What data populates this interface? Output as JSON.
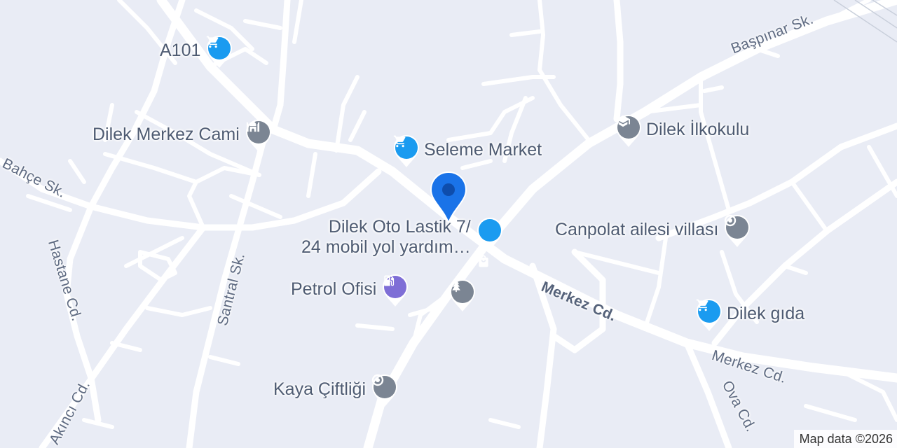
{
  "map": {
    "street_labels": {
      "bahce": "Bahçe Sk.",
      "baspinar": "Başpınar Sk.",
      "hastane": "Hastane Cd.",
      "santral": "Santral Sk.",
      "akinci": "Akıncı Cd.",
      "merkez_center": "Merkez Cd.",
      "merkez_right": "Merkez Cd.",
      "ova": "Ova Cd."
    },
    "pois": {
      "a101": {
        "label": "A101",
        "icon": "shopping-cart-icon",
        "color": "#1a9bf0"
      },
      "dilek_merkez_cami": {
        "label": "Dilek Merkez Cami",
        "icon": "mosque-icon",
        "color": "#7b8593"
      },
      "seleme_market": {
        "label": "Seleme Market",
        "icon": "shopping-cart-icon",
        "color": "#1a9bf0"
      },
      "dilek_ilkokulu": {
        "label": "Dilek İlkokulu",
        "icon": "school-icon",
        "color": "#7b8593"
      },
      "dilek_oto_lastik": {
        "label_line1": "Dilek Oto Lastik 7/",
        "label_line2": "24 mobil yol yardım…",
        "icon": "shopping-bag-icon",
        "color": "#1a9bf0"
      },
      "canpolat": {
        "label": "Canpolat ailesi villası",
        "icon": "place-icon",
        "color": "#7b8593"
      },
      "petrol_ofisi": {
        "label": "Petrol Ofisi",
        "icon": "gas-station-icon",
        "color": "#7e6ed6"
      },
      "park": {
        "icon": "park-icon",
        "color": "#7b8593"
      },
      "dilek_gida": {
        "label": "Dilek gıda",
        "icon": "shopping-cart-icon",
        "color": "#1a9bf0"
      },
      "kaya_ciftligi": {
        "label": "Kaya Çiftliği",
        "icon": "place-icon",
        "color": "#7b8593"
      }
    },
    "marker": {
      "icon": "location-marker-icon",
      "color": "#1a73e8"
    },
    "attribution": "Map data ©2026"
  }
}
